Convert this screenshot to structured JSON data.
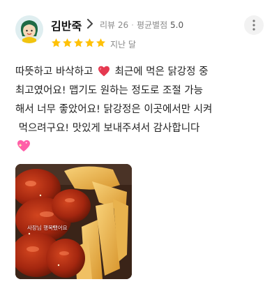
{
  "review": {
    "reviewer_name": "김반죽",
    "review_count": "리뷰 26",
    "avg_rating_label": "평균별점",
    "avg_rating_value": "5.0",
    "star_rating": 5,
    "date": "지난 달",
    "text_part1": "따뜻하고 바삭하고 ",
    "text_part2": " 최근에 먹은 닭강정 중\n최고였어요! 맵기도 원하는 정도로 조절 가능\n해서 너무 좋았어요! 닭강정은 이곳에서만 시켜\n 먹으려구요! 맛있게 보내주셔서 감사합니다\n",
    "photo_caption": "사장님 행복했어요",
    "colors": {
      "star": "#ffc107",
      "heart": "#e53950",
      "sparkle_heart": "#ff5fa8"
    }
  }
}
